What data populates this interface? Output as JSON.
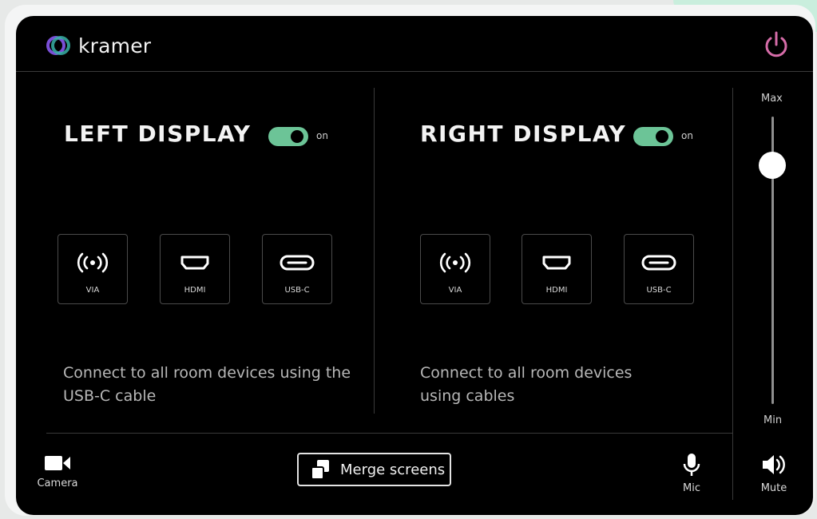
{
  "brand": {
    "name": "kramer"
  },
  "left_display": {
    "title": "LEFT DISPLAY",
    "toggle_label": "on",
    "sources": [
      {
        "label": "VIA",
        "icon": "wireless-icon"
      },
      {
        "label": "HDMI",
        "icon": "hdmi-icon"
      },
      {
        "label": "USB-C",
        "icon": "usbc-icon"
      }
    ],
    "description": "Connect to all room devices using the USB-C cable"
  },
  "right_display": {
    "title": "RIGHT DISPLAY",
    "toggle_label": "on",
    "sources": [
      {
        "label": "VIA",
        "icon": "wireless-icon"
      },
      {
        "label": "HDMI",
        "icon": "hdmi-icon"
      },
      {
        "label": "USB-C",
        "icon": "usbc-icon"
      }
    ],
    "description": "Connect to all room devices using cables"
  },
  "volume": {
    "max_label": "Max",
    "min_label": "Min",
    "level": 0.83
  },
  "bottom": {
    "camera_label": "Camera",
    "merge_label": "Merge screens",
    "mic_label": "Mic",
    "mute_label": "Mute"
  },
  "colors": {
    "toggle_on": "#6cc497",
    "power": "#d56ca8",
    "logo_purple": "#7a4fd6",
    "logo_teal": "#38b2a6"
  }
}
